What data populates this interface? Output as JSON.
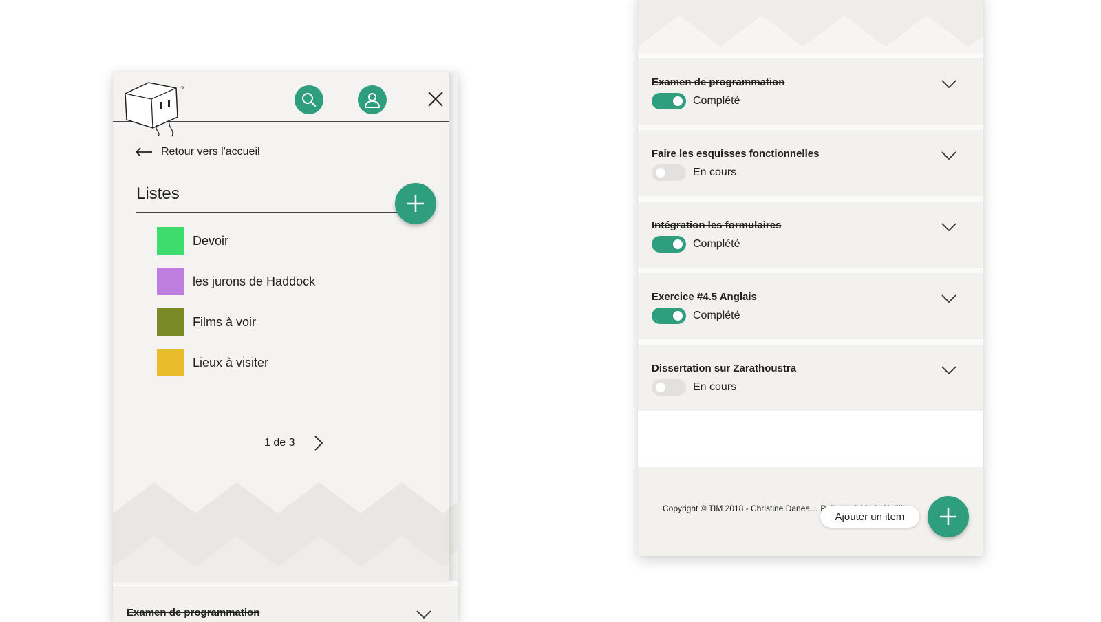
{
  "left_screen": {
    "back_link": "Retour vers l'accueil",
    "lists_title": "Listes",
    "lists": [
      {
        "label": "Devoir",
        "color": "#3ddc6d"
      },
      {
        "label": "les jurons de Haddock",
        "color": "#bd7ee0"
      },
      {
        "label": "Films à voir",
        "color": "#7a8a26"
      },
      {
        "label": "Lieux à visiter",
        "color": "#e8bc2a"
      }
    ],
    "pagination": "1 de 3",
    "peek_task": "Examen de programmation"
  },
  "right_screen": {
    "tasks": [
      {
        "title": "Examen de programmation",
        "status": "Complété",
        "done": true
      },
      {
        "title": "Faire les esquisses fonctionnelles",
        "status": "En cours",
        "done": false
      },
      {
        "title": "Intégration les formulaires",
        "status": "Complété",
        "done": true
      },
      {
        "title": "Exercice #4.5 Anglais",
        "status": "Complété",
        "done": true
      },
      {
        "title": "Dissertation sur Zarathoustra",
        "status": "En cours",
        "done": false
      }
    ],
    "copyright": "Copyright © TIM 2018 - Christine Danea… Pelletier & Marie-Noëlle",
    "add_item_tooltip": "Ajouter un item"
  },
  "colors": {
    "accent": "#2f9e7f",
    "panel_bg": "#f4f3f1"
  },
  "icons": [
    "logo-cube",
    "search-icon",
    "user-icon",
    "close-icon",
    "arrow-left-icon",
    "plus-icon",
    "chevron-right-icon",
    "chevron-down-icon"
  ]
}
